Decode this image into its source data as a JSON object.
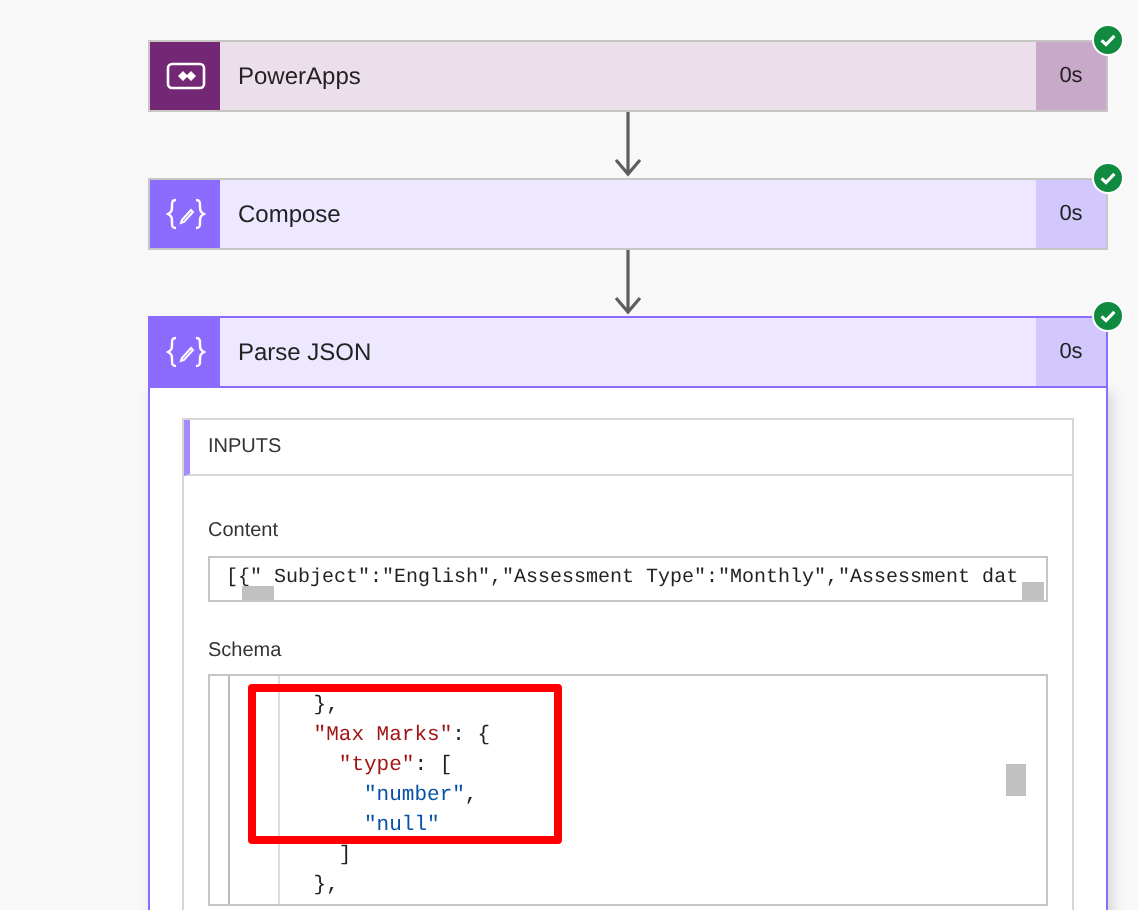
{
  "steps": [
    {
      "kind": "powerapps",
      "title": "PowerApps",
      "duration": "0s",
      "succeeded": true
    },
    {
      "kind": "compose",
      "title": "Compose",
      "duration": "0s",
      "succeeded": true
    },
    {
      "kind": "parse",
      "title": "Parse JSON",
      "duration": "0s",
      "succeeded": true,
      "expanded": true
    }
  ],
  "inputs": {
    "heading": "INPUTS",
    "content": {
      "label": "Content",
      "value": "[{\" Subject\":\"English\",\"Assessment Type\":\"Monthly\",\"Assessment dat"
    },
    "schema": {
      "label": "Schema",
      "lines": [
        [
          {
            "text": "      },",
            "kind": "plain"
          }
        ],
        [
          {
            "text": "      \"Max Marks\"",
            "kind": "key"
          },
          {
            "text": ": {",
            "kind": "plain"
          }
        ],
        [
          {
            "text": "        \"type\"",
            "kind": "key"
          },
          {
            "text": ": [",
            "kind": "plain"
          }
        ],
        [
          {
            "text": "          \"number\"",
            "kind": "string"
          },
          {
            "text": ",",
            "kind": "plain"
          }
        ],
        [
          {
            "text": "          \"null\"",
            "kind": "string"
          }
        ],
        [
          {
            "text": "        ]",
            "kind": "plain"
          }
        ],
        [
          {
            "text": "      },",
            "kind": "plain"
          }
        ]
      ]
    }
  }
}
